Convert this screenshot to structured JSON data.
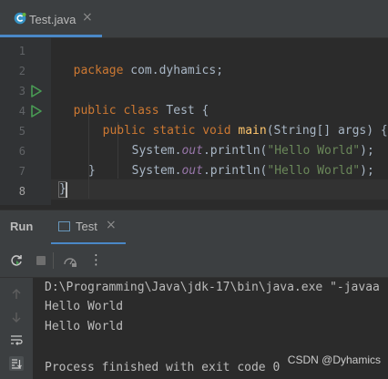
{
  "editor": {
    "tab": {
      "label": "Test.java",
      "close": "×"
    },
    "line_numbers": [
      "1",
      "2",
      "3",
      "4",
      "5",
      "6",
      "7",
      "8"
    ],
    "code": {
      "l1_kw": "package",
      "l1_rest": " com.dyhamics;",
      "l3_kw1": "public",
      "l3_kw2": "class",
      "l3_name": " Test {",
      "l4_kw": "public static void",
      "l4_fn": "main",
      "l4_rest": "(String[] args) {",
      "l5_a": "System.",
      "l5_static": "out",
      "l5_b": ".println(",
      "l5_str": "\"Hello World\"",
      "l5_c": ");",
      "l6_a": "System.",
      "l6_static": "out",
      "l6_b": ".println(",
      "l6_str": "\"Hello World\"",
      "l6_c": ");",
      "l7": "}",
      "l8": "}"
    }
  },
  "run_panel": {
    "title": "Run",
    "tab_label": "Test",
    "tab_close": "×"
  },
  "toolbar": {
    "more": "⋮"
  },
  "console": {
    "lines": [
      "D:\\Programming\\Java\\jdk-17\\bin\\java.exe \"-javaa",
      "Hello World",
      "Hello World",
      "",
      "Process finished with exit code 0"
    ]
  },
  "watermark": "CSDN @Dyhamics",
  "colors": {
    "keyword": "#cc7832",
    "method": "#ffc66d",
    "string": "#6a8759",
    "static_field": "#9876aa",
    "run_arrow": "#499c54",
    "accent": "#4a88c7"
  }
}
